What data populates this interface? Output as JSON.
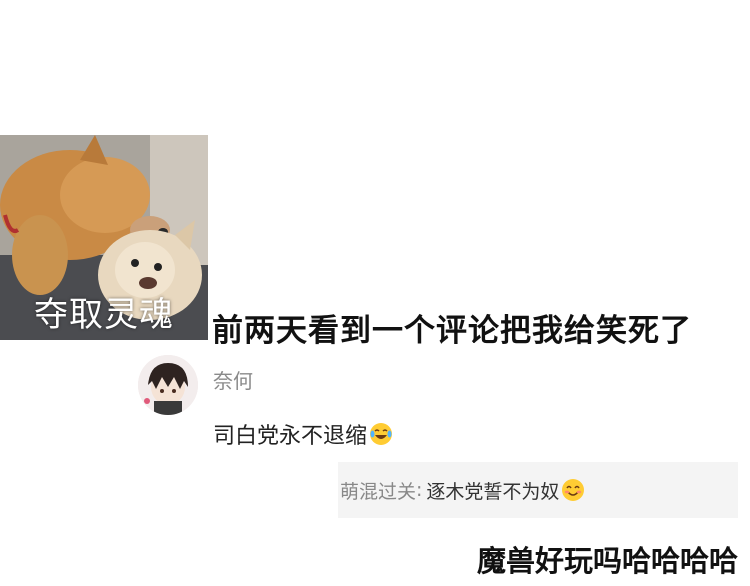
{
  "meme": {
    "caption": "夺取灵魂"
  },
  "headline": "前两天看到一个评论把我给笑死了",
  "comment": {
    "username": "奈何",
    "text": "司白党永不退缩",
    "emoji": "laughing-tears-emoji"
  },
  "reply": {
    "username": "萌混过关",
    "colon": ":",
    "text": "逐木党誓不为奴",
    "emoji": "blushing-smile-emoji"
  },
  "footer": "魔兽好玩吗哈哈哈哈"
}
